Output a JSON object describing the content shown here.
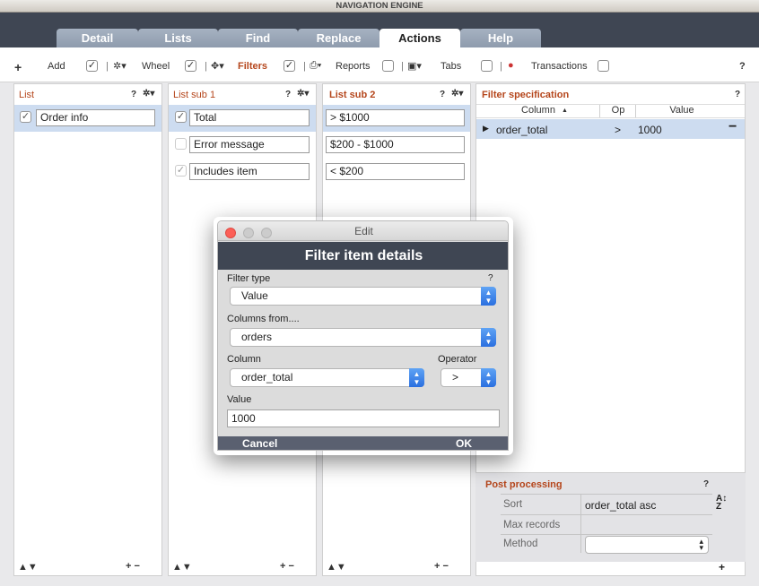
{
  "window": {
    "title": "NAVIGATION ENGINE"
  },
  "tabs": [
    "Detail",
    "Lists",
    "Find",
    "Replace",
    "Actions",
    "Help"
  ],
  "toolbar": {
    "add": "Add",
    "wheel": "Wheel",
    "filters": "Filters",
    "reports": "Reports",
    "tabs": "Tabs",
    "transactions": "Transactions",
    "help": "?",
    "plus": "+"
  },
  "panels": {
    "list": {
      "title": "List",
      "items": [
        {
          "label": "Order info",
          "checked": true
        }
      ]
    },
    "sub1": {
      "title": "List sub 1",
      "items": [
        {
          "label": "Total",
          "checked": true
        },
        {
          "label": "Error message",
          "checked": false
        },
        {
          "label": "Includes item",
          "checked": true
        }
      ]
    },
    "sub2": {
      "title": "List sub 2",
      "items": [
        {
          "label": "> $1000"
        },
        {
          "label": "$200 - $1000"
        },
        {
          "label": "< $200"
        }
      ]
    }
  },
  "filter_spec": {
    "title": "Filter specification",
    "columns": [
      "Column",
      "Op",
      "Value"
    ],
    "rows": [
      {
        "column": "order_total",
        "op": ">",
        "value": "1000"
      }
    ]
  },
  "post": {
    "title": "Post processing",
    "sort_label": "Sort",
    "sort_value": "order_total asc",
    "max_label": "Max records",
    "max_value": "",
    "method_label": "Method",
    "method_value": ""
  },
  "dialog": {
    "window_title": "Edit",
    "header": "Filter item details",
    "filter_type_label": "Filter type",
    "filter_type_value": "Value",
    "columns_from_label": "Columns from....",
    "columns_from_value": "orders",
    "column_label": "Column",
    "column_value": "order_total",
    "operator_label": "Operator",
    "operator_value": ">",
    "value_label": "Value",
    "value_value": "1000",
    "cancel": "Cancel",
    "ok": "OK",
    "help": "?"
  },
  "common": {
    "help": "?",
    "gear": "✲",
    "up_down": "▲▼",
    "plus_minus": "+ −",
    "plus": "+",
    "minus": "−"
  },
  "colors": {
    "accent": "#b5461c",
    "selection": "#cddcf0",
    "dialog_header": "#3f4653",
    "select_blue": "#2a6fe0"
  }
}
